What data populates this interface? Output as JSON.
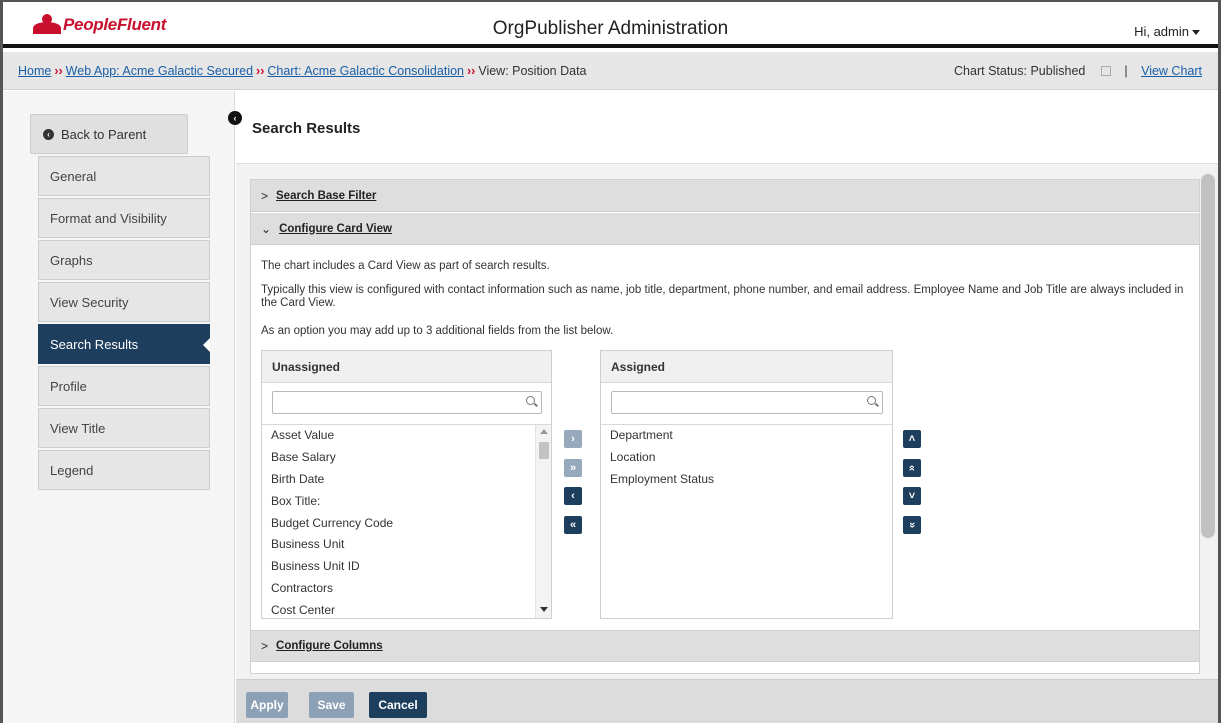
{
  "header": {
    "brand": "PeopleFluent",
    "title": "OrgPublisher Administration",
    "user_greeting": "Hi, admin"
  },
  "breadcrumb": {
    "home": "Home",
    "sep": "››",
    "web_app": "Web App: Acme Galactic Secured",
    "chart": "Chart: Acme Galactic Consolidation",
    "view": "View: Position Data"
  },
  "status": {
    "label": "Chart Status:",
    "value": "Published",
    "divider": "|",
    "view_chart": "View Chart"
  },
  "sidebar": {
    "back": "Back to Parent",
    "items": [
      {
        "label": "General"
      },
      {
        "label": "Format and Visibility"
      },
      {
        "label": "Graphs"
      },
      {
        "label": "View Security"
      },
      {
        "label": "Search Results"
      },
      {
        "label": "Profile"
      },
      {
        "label": "View Title"
      },
      {
        "label": "Legend"
      }
    ],
    "active_index": 4
  },
  "main": {
    "title": "Search Results",
    "sections": {
      "search_base_filter": "Search Base Filter",
      "configure_card_view": "Configure Card View",
      "configure_columns": "Configure Columns"
    },
    "card_view": {
      "para1": "The chart includes a Card View as part of search results.",
      "para2": "Typically this view is configured with contact information such as name, job title, department, phone number, and email address. Employee Name and Job Title are always included in the Card View.",
      "para3": "As an option you may add up to 3 additional fields from the list below."
    }
  },
  "unassigned": {
    "header": "Unassigned",
    "search_value": "",
    "items": [
      "Asset Value",
      "Base Salary",
      "Birth Date",
      "Box Title:",
      "Budget Currency Code",
      "Business Unit",
      "Business Unit ID",
      "Contractors",
      "Cost Center"
    ]
  },
  "assigned": {
    "header": "Assigned",
    "search_value": "",
    "items": [
      "Department",
      "Location",
      "Employment Status"
    ]
  },
  "transfer_buttons": {
    "move_right": "›",
    "move_all_right": "»",
    "move_left": "‹",
    "move_all_left": "«"
  },
  "order_buttons": {
    "up": "˄",
    "top": "»",
    "down": "˅",
    "bottom": "»"
  },
  "footer": {
    "apply": "Apply",
    "save": "Save",
    "cancel": "Cancel"
  },
  "colors": {
    "brand_red": "#c8102e",
    "nav_active": "#1e3e5e",
    "link": "#1a5fa8"
  }
}
